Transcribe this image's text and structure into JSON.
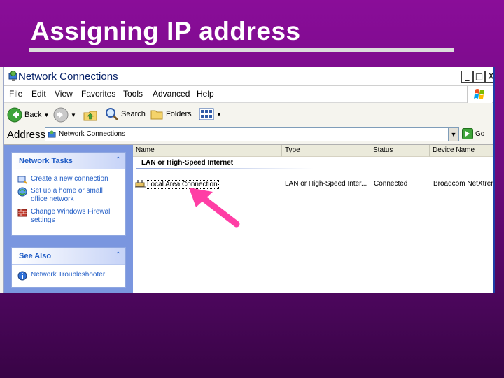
{
  "slide": {
    "title": "Assigning IP address"
  },
  "window": {
    "title": "Network Connections",
    "controls": {
      "minimize": "_",
      "maximize": "□",
      "close": "X"
    }
  },
  "menu": [
    "File",
    "Edit",
    "View",
    "Favorites",
    "Tools",
    "Advanced",
    "Help"
  ],
  "toolbar": {
    "back": "Back",
    "search": "Search",
    "folders": "Folders"
  },
  "address": {
    "label": "Address",
    "value": "Network Connections",
    "go": "Go"
  },
  "tasks": {
    "network_tasks": {
      "title": "Network Tasks",
      "items": [
        "Create a new connection",
        "Set up a home or small office network",
        "Change Windows Firewall settings"
      ]
    },
    "see_also": {
      "title": "See Also",
      "items": [
        "Network Troubleshooter"
      ]
    }
  },
  "list": {
    "columns": [
      "Name",
      "Type",
      "Status",
      "Device Name"
    ],
    "group": "LAN or High-Speed Internet",
    "rows": [
      {
        "name": "Local Area Connection",
        "type": "LAN or High-Speed Inter...",
        "status": "Connected",
        "device": "Broadcom NetXtrem"
      }
    ]
  },
  "colors": {
    "slide_bg": "#7a0b8a",
    "title_rule": "#dcdcdc",
    "task_pane": "#7a96df",
    "task_link": "#215dc6",
    "arrow": "#ff3ea5"
  }
}
